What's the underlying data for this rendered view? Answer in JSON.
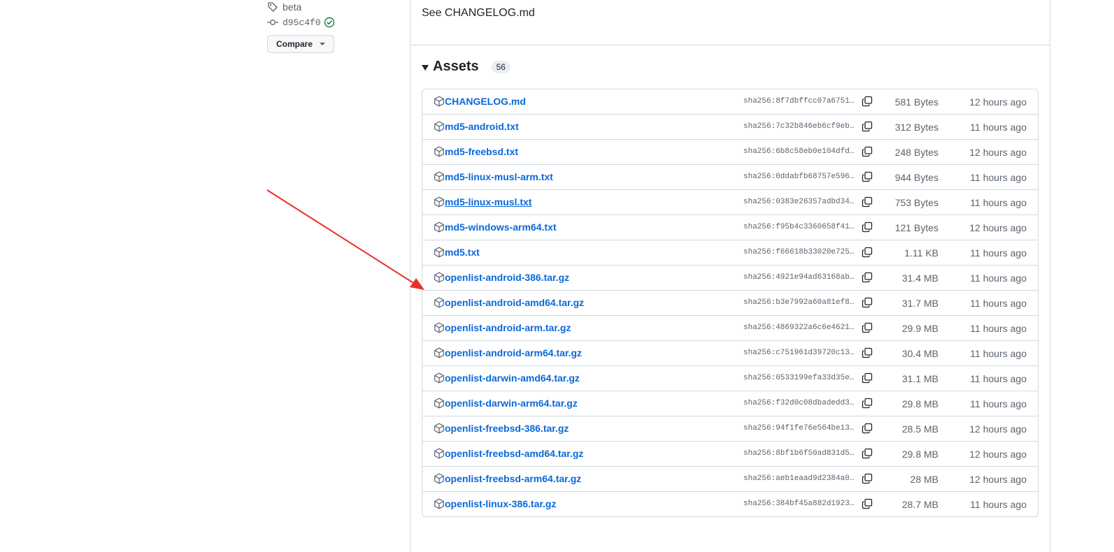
{
  "sidebar": {
    "tag_label": "beta",
    "commit_hash": "d95c4f0",
    "compare_label": "Compare"
  },
  "release": {
    "notes_text": "See CHANGELOG.md",
    "assets_title": "Assets",
    "assets_count": "56"
  },
  "assets": [
    {
      "name": "CHANGELOG.md",
      "sha": "sha256:8f7dbffcc07a6751…",
      "size": "581 Bytes",
      "time": "12 hours ago"
    },
    {
      "name": "md5-android.txt",
      "sha": "sha256:7c32b846eb6cf9eb…",
      "size": "312 Bytes",
      "time": "11 hours ago"
    },
    {
      "name": "md5-freebsd.txt",
      "sha": "sha256:6b8c58eb0e104dfd…",
      "size": "248 Bytes",
      "time": "12 hours ago"
    },
    {
      "name": "md5-linux-musl-arm.txt",
      "sha": "sha256:0ddabfb68757e596…",
      "size": "944 Bytes",
      "time": "11 hours ago"
    },
    {
      "name": "md5-linux-musl.txt",
      "sha": "sha256:0383e26357adbd34…",
      "size": "753 Bytes",
      "time": "11 hours ago"
    },
    {
      "name": "md5-windows-arm64.txt",
      "sha": "sha256:f95b4c3360658f41…",
      "size": "121 Bytes",
      "time": "12 hours ago"
    },
    {
      "name": "md5.txt",
      "sha": "sha256:f66618b33020e725…",
      "size": "1.11 KB",
      "time": "11 hours ago"
    },
    {
      "name": "openlist-android-386.tar.gz",
      "sha": "sha256:4921e94ad63168ab…",
      "size": "31.4 MB",
      "time": "11 hours ago"
    },
    {
      "name": "openlist-android-amd64.tar.gz",
      "sha": "sha256:b3e7992a60a81ef8…",
      "size": "31.7 MB",
      "time": "11 hours ago"
    },
    {
      "name": "openlist-android-arm.tar.gz",
      "sha": "sha256:4869322a6c6e4621…",
      "size": "29.9 MB",
      "time": "11 hours ago"
    },
    {
      "name": "openlist-android-arm64.tar.gz",
      "sha": "sha256:c751961d39720c13…",
      "size": "30.4 MB",
      "time": "11 hours ago"
    },
    {
      "name": "openlist-darwin-amd64.tar.gz",
      "sha": "sha256:0533199efa33d35e…",
      "size": "31.1 MB",
      "time": "11 hours ago"
    },
    {
      "name": "openlist-darwin-arm64.tar.gz",
      "sha": "sha256:f32d0c08dbadedd3…",
      "size": "29.8 MB",
      "time": "11 hours ago"
    },
    {
      "name": "openlist-freebsd-386.tar.gz",
      "sha": "sha256:94f1fe76e564be13…",
      "size": "28.5 MB",
      "time": "12 hours ago"
    },
    {
      "name": "openlist-freebsd-amd64.tar.gz",
      "sha": "sha256:8bf1b6f50ad831d5…",
      "size": "29.8 MB",
      "time": "12 hours ago"
    },
    {
      "name": "openlist-freebsd-arm64.tar.gz",
      "sha": "sha256:aeb1eaad9d2384a0…",
      "size": "28 MB",
      "time": "12 hours ago"
    },
    {
      "name": "openlist-linux-386.tar.gz",
      "sha": "sha256:384bf45a882d1923…",
      "size": "28.7 MB",
      "time": "11 hours ago"
    }
  ],
  "colors": {
    "link": "#0969da",
    "annotation_arrow": "#e8312b",
    "verified_check": "#1a7f37"
  }
}
